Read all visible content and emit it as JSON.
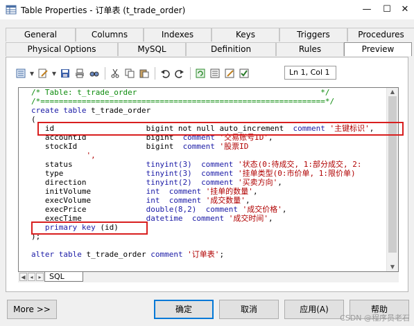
{
  "window": {
    "title": "Table Properties - 订单表 (t_trade_order)",
    "controls": {
      "minimize": "—",
      "maximize": "☐",
      "close": "✕"
    }
  },
  "tabs": {
    "row1": [
      {
        "label": "General"
      },
      {
        "label": "Columns"
      },
      {
        "label": "Indexes"
      },
      {
        "label": "Keys"
      },
      {
        "label": "Triggers"
      },
      {
        "label": "Procedures"
      }
    ],
    "row2": [
      {
        "label": "Physical Options"
      },
      {
        "label": "MySQL"
      },
      {
        "label": "Definition"
      },
      {
        "label": "Rules"
      },
      {
        "label": "Preview",
        "active": true
      }
    ]
  },
  "toolbar": {
    "icons": [
      "properties-icon",
      "dropdown-arrow-icon",
      "edit-icon",
      "dropdown-arrow-icon",
      "save-icon",
      "print-icon",
      "find-icon",
      "cut-icon",
      "copy-icon",
      "paste-icon",
      "undo-icon",
      "redo-icon",
      "refresh-icon",
      "list-icon",
      "edit-script-icon",
      "check-icon"
    ],
    "cursor_position": "Ln 1, Col 1"
  },
  "code": {
    "lines": [
      {
        "parts": [
          {
            "t": "/* Table: t_trade_order                                        */",
            "c": "comment"
          }
        ]
      },
      {
        "parts": [
          {
            "t": "/*==============================================================*/",
            "c": "comment"
          }
        ]
      },
      {
        "parts": [
          {
            "t": "create table ",
            "c": "kw"
          },
          {
            "t": "t_trade_order",
            "c": "plain"
          }
        ]
      },
      {
        "parts": [
          {
            "t": "(",
            "c": "plain"
          }
        ]
      },
      {
        "parts": [
          {
            "t": "   id                    ",
            "c": "plain"
          },
          {
            "t": "bigint not null auto_increment  ",
            "c": "plain"
          },
          {
            "t": "comment ",
            "c": "kw"
          },
          {
            "t": "'主键标识'",
            "c": "str"
          },
          {
            "t": ",",
            "c": "plain"
          }
        ]
      },
      {
        "parts": [
          {
            "t": "   accountId             ",
            "c": "plain"
          },
          {
            "t": "bigint  ",
            "c": "plain"
          },
          {
            "t": "comment ",
            "c": "kw"
          },
          {
            "t": "'交易账号ID'",
            "c": "str"
          },
          {
            "t": ",",
            "c": "plain"
          }
        ]
      },
      {
        "parts": [
          {
            "t": "   stockId               ",
            "c": "plain"
          },
          {
            "t": "bigint  ",
            "c": "plain"
          },
          {
            "t": "comment ",
            "c": "kw"
          },
          {
            "t": "'股票ID",
            "c": "str"
          }
        ]
      },
      {
        "parts": [
          {
            "t": "            ',",
            "c": "str"
          }
        ]
      },
      {
        "parts": [
          {
            "t": "   status                ",
            "c": "plain"
          },
          {
            "t": "tinyint(3)  ",
            "c": "kw"
          },
          {
            "t": "comment ",
            "c": "kw"
          },
          {
            "t": "'状态(0:待成交, 1:部分成交, 2:",
            "c": "str"
          }
        ]
      },
      {
        "parts": [
          {
            "t": "   type                  ",
            "c": "plain"
          },
          {
            "t": "tinyint(3)  ",
            "c": "kw"
          },
          {
            "t": "comment ",
            "c": "kw"
          },
          {
            "t": "'挂单类型(0:市价单, 1:限价单)",
            "c": "str"
          }
        ]
      },
      {
        "parts": [
          {
            "t": "   direction             ",
            "c": "plain"
          },
          {
            "t": "tinyint(2)  ",
            "c": "kw"
          },
          {
            "t": "comment ",
            "c": "kw"
          },
          {
            "t": "'买卖方向'",
            "c": "str"
          },
          {
            "t": ",",
            "c": "plain"
          }
        ]
      },
      {
        "parts": [
          {
            "t": "   initVolume            ",
            "c": "plain"
          },
          {
            "t": "int  ",
            "c": "kw"
          },
          {
            "t": "comment ",
            "c": "kw"
          },
          {
            "t": "'挂单的数量'",
            "c": "str"
          },
          {
            "t": ",",
            "c": "plain"
          }
        ]
      },
      {
        "parts": [
          {
            "t": "   execVolume            ",
            "c": "plain"
          },
          {
            "t": "int  ",
            "c": "kw"
          },
          {
            "t": "comment ",
            "c": "kw"
          },
          {
            "t": "'成交数量'",
            "c": "str"
          },
          {
            "t": ",",
            "c": "plain"
          }
        ]
      },
      {
        "parts": [
          {
            "t": "   execPrice             ",
            "c": "plain"
          },
          {
            "t": "double(8,2)  ",
            "c": "kw"
          },
          {
            "t": "comment ",
            "c": "kw"
          },
          {
            "t": "'成交价格'",
            "c": "str"
          },
          {
            "t": ",",
            "c": "plain"
          }
        ]
      },
      {
        "parts": [
          {
            "t": "   execTime              ",
            "c": "plain"
          },
          {
            "t": "datetime  ",
            "c": "kw"
          },
          {
            "t": "comment ",
            "c": "kw"
          },
          {
            "t": "'成交时间'",
            "c": "str"
          },
          {
            "t": ",",
            "c": "plain"
          }
        ]
      },
      {
        "parts": [
          {
            "t": "   primary key ",
            "c": "kw"
          },
          {
            "t": "(id)",
            "c": "plain"
          }
        ]
      },
      {
        "parts": [
          {
            "t": ");",
            "c": "plain"
          }
        ]
      },
      {
        "parts": [
          {
            "t": "",
            "c": "plain"
          }
        ]
      },
      {
        "parts": [
          {
            "t": "alter table ",
            "c": "kw"
          },
          {
            "t": "t_trade_order ",
            "c": "plain"
          },
          {
            "t": "comment ",
            "c": "kw"
          },
          {
            "t": "'订单表'",
            "c": "str"
          },
          {
            "t": ";",
            "c": "plain"
          }
        ]
      }
    ]
  },
  "bottom_tab": {
    "label": "SQL"
  },
  "buttons": {
    "more": "More >>",
    "ok": "确定",
    "cancel": "取消",
    "apply": "应用(A)",
    "help": "帮助"
  },
  "watermark": "CSDN @程序员老石",
  "colors": {
    "comment": "#0b8a0b",
    "keyword": "#1a1aa6",
    "string": "#b00000",
    "highlight_box": "#d81e1e",
    "default_button_border": "#0078d7"
  }
}
